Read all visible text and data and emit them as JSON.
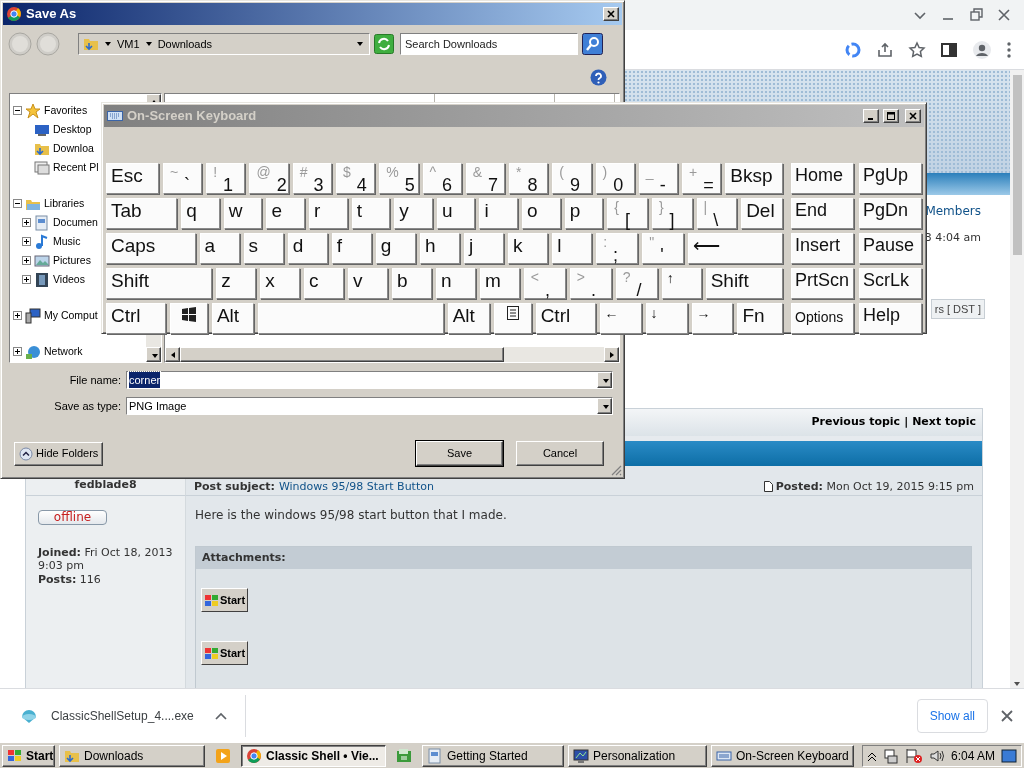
{
  "browser": {
    "info": {
      "members_link": "Members",
      "last_visit": "3 4:04 am",
      "timezone": "rs [ DST ]"
    },
    "topic_nav": {
      "previous": "Previous topic",
      "separator": "|",
      "next": "Next topic"
    },
    "post": {
      "author": "fedblade8",
      "subject_label": "Post subject:",
      "subject": "Windows 95/98 Start Button",
      "posted": "**Posted:** Mon Oct 19, 2015 9:15 pm",
      "status": "offline",
      "joined": "**Joined:** Fri Oct 18, 2013 9:03 pm",
      "posts": "**Posts:** 116",
      "body": "Here is the windows 95/98 start button that I made.",
      "attachments_title": "Attachments:",
      "attachments": [
        {
          "label": "Start"
        },
        {
          "label": "Start"
        }
      ]
    },
    "downloads": {
      "file": "ClassicShellSetup_4....exe",
      "show_all": "Show all"
    }
  },
  "save_dialog": {
    "title": "Save As",
    "breadcrumb": [
      "VM1",
      "Downloads"
    ],
    "search": {
      "placeholder": "Search Downloads"
    },
    "tree": [
      {
        "label": "Favorites",
        "expanded": true,
        "children": [
          {
            "label": "Desktop"
          },
          {
            "label": "Downloa"
          },
          {
            "label": "Recent Pl"
          }
        ]
      },
      {
        "label": "Libraries",
        "expanded": true,
        "children": [
          {
            "label": "Documen",
            "expanded": false
          },
          {
            "label": "Music",
            "expanded": false
          },
          {
            "label": "Pictures",
            "expanded": false
          },
          {
            "label": "Videos",
            "expanded": false
          }
        ]
      },
      {
        "label": "My Comput",
        "expanded": false
      },
      {
        "label": "Network",
        "expanded": false
      }
    ],
    "file_name": {
      "label": "File name:",
      "value": "corner",
      "text_selected": true
    },
    "save_type": {
      "label": "Save as type:",
      "value": "PNG Image"
    },
    "hide_folders": "Hide Folders",
    "buttons": [
      "Save",
      "Cancel"
    ]
  },
  "keyboard": {
    "title": "On-Screen Keyboard",
    "rows": [
      {
        "keys": [
          {
            "kind": "esc",
            "label": "Esc"
          },
          {
            "kind": "char",
            "shift": "~",
            "label": "`"
          },
          {
            "kind": "char",
            "shift": "!",
            "label": "1"
          },
          {
            "kind": "char",
            "shift": "@",
            "label": "2"
          },
          {
            "kind": "char",
            "shift": "#",
            "label": "3"
          },
          {
            "kind": "char",
            "shift": "$",
            "label": "4"
          },
          {
            "kind": "char",
            "shift": "%",
            "label": "5"
          },
          {
            "kind": "char",
            "shift": "^",
            "label": "6"
          },
          {
            "kind": "char",
            "shift": "&",
            "label": "7"
          },
          {
            "kind": "char",
            "shift": "*",
            "label": "8"
          },
          {
            "kind": "char",
            "shift": "(",
            "label": "9"
          },
          {
            "kind": "char",
            "shift": ")",
            "label": "0"
          },
          {
            "kind": "char",
            "shift": "_",
            "label": "-"
          },
          {
            "kind": "char",
            "shift": "+",
            "label": "="
          },
          {
            "kind": "bksp",
            "label": "Bksp"
          }
        ]
      },
      {
        "keys": [
          {
            "kind": "tab",
            "label": "Tab"
          },
          {
            "kind": "char",
            "label": "q"
          },
          {
            "kind": "char",
            "label": "w"
          },
          {
            "kind": "char",
            "label": "e"
          },
          {
            "kind": "char",
            "label": "r"
          },
          {
            "kind": "char",
            "label": "t"
          },
          {
            "kind": "char",
            "label": "y"
          },
          {
            "kind": "char",
            "label": "u"
          },
          {
            "kind": "char",
            "label": "i"
          },
          {
            "kind": "char",
            "label": "o"
          },
          {
            "kind": "char",
            "label": "p"
          },
          {
            "kind": "char",
            "shift": "{",
            "label": "["
          },
          {
            "kind": "char",
            "shift": "}",
            "label": "]"
          },
          {
            "kind": "char",
            "shift": "|",
            "label": "\\"
          },
          {
            "kind": "del",
            "label": "Del"
          }
        ]
      },
      {
        "keys": [
          {
            "kind": "caps",
            "label": "Caps"
          },
          {
            "kind": "char",
            "label": "a"
          },
          {
            "kind": "char",
            "label": "s"
          },
          {
            "kind": "char",
            "label": "d"
          },
          {
            "kind": "char",
            "label": "f"
          },
          {
            "kind": "char",
            "label": "g"
          },
          {
            "kind": "char",
            "label": "h"
          },
          {
            "kind": "char",
            "label": "j"
          },
          {
            "kind": "char",
            "label": "k"
          },
          {
            "kind": "char",
            "label": "l"
          },
          {
            "kind": "char",
            "shift": ":",
            "label": ";"
          },
          {
            "kind": "char",
            "shift": "\"",
            "label": "'"
          },
          {
            "kind": "enter",
            "label": "⟵"
          }
        ]
      },
      {
        "keys": [
          {
            "kind": "shift-left",
            "label": "Shift"
          },
          {
            "kind": "char",
            "label": "z"
          },
          {
            "kind": "char",
            "label": "x"
          },
          {
            "kind": "char",
            "label": "c"
          },
          {
            "kind": "char",
            "label": "v"
          },
          {
            "kind": "char",
            "label": "b"
          },
          {
            "kind": "char",
            "label": "n"
          },
          {
            "kind": "char",
            "label": "m"
          },
          {
            "kind": "char",
            "shift": "<",
            "label": ","
          },
          {
            "kind": "char",
            "shift": ">",
            "label": "."
          },
          {
            "kind": "char",
            "shift": "?",
            "label": "/"
          },
          {
            "kind": "arrow",
            "label": "↑"
          },
          {
            "kind": "shift-right",
            "label": "Shift"
          }
        ]
      },
      {
        "keys": [
          {
            "kind": "ctrl",
            "label": "Ctrl"
          },
          {
            "kind": "win"
          },
          {
            "kind": "alt",
            "label": "Alt"
          },
          {
            "kind": "space"
          },
          {
            "kind": "alt",
            "label": "Alt"
          },
          {
            "kind": "menu"
          },
          {
            "kind": "ctrl",
            "label": "Ctrl"
          },
          {
            "kind": "arrow",
            "label": "←"
          },
          {
            "kind": "arrow",
            "label": "↓"
          },
          {
            "kind": "arrow",
            "label": "→"
          },
          {
            "kind": "fn",
            "label": "Fn"
          }
        ]
      }
    ],
    "nav_keys": [
      {
        "kind": "nav",
        "label": "Home"
      },
      {
        "kind": "nav",
        "label": "PgUp"
      },
      {
        "kind": "nav",
        "label": "End"
      },
      {
        "kind": "nav",
        "label": "PgDn"
      },
      {
        "kind": "nav",
        "label": "Insert"
      },
      {
        "kind": "nav",
        "label": "Pause"
      },
      {
        "kind": "nav",
        "label": "PrtScn"
      },
      {
        "kind": "nav",
        "label": "ScrLk"
      },
      {
        "kind": "small",
        "label": "Options"
      },
      {
        "kind": "nav",
        "label": "Help"
      }
    ]
  },
  "taskbar": {
    "start": "Start",
    "items": [
      {
        "kind": "window",
        "label": "Downloads",
        "selected": false
      },
      {
        "kind": "launcher"
      },
      {
        "kind": "window",
        "label": "Classic Shell • Vie...",
        "selected": true
      },
      {
        "kind": "launcher"
      },
      {
        "kind": "window",
        "label": "Getting Started",
        "selected": false
      },
      {
        "kind": "window",
        "label": "Personalization",
        "selected": false
      },
      {
        "kind": "window",
        "label": "On-Screen Keyboard",
        "selected": false
      }
    ],
    "clock": "6:04 AM"
  }
}
